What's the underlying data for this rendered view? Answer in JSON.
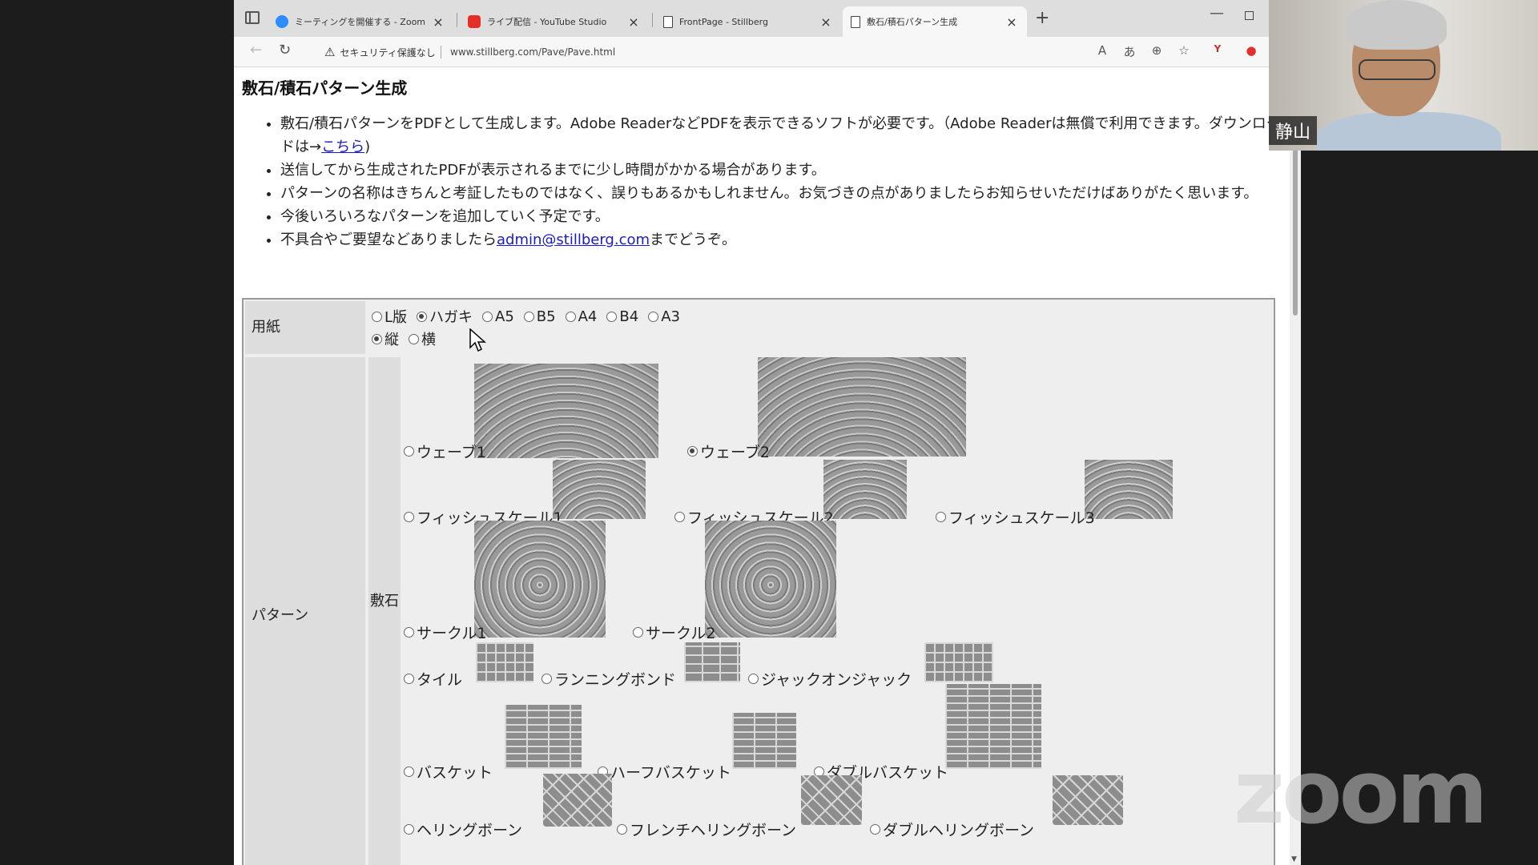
{
  "browser": {
    "tabs": [
      {
        "label": "ミーティングを開催する - Zoom",
        "favicon": "zoom-icon"
      },
      {
        "label": "ライブ配信 - YouTube Studio",
        "favicon": "youtube-icon"
      },
      {
        "label": "FrontPage - Stillberg",
        "favicon": "document-icon"
      },
      {
        "label": "敷石/積石パターン生成",
        "favicon": "document-icon",
        "active": true
      }
    ],
    "security_label": "セキュリティ保護なし",
    "url": "www.stillberg.com/Pave/Pave.html"
  },
  "page": {
    "title": "敷石/積石パターン生成",
    "bullets": {
      "b1_text": "敷石/積石パターンをPDFとして生成します。Adobe ReaderなどPDFを表示できるソフトが必要です。（Adobe Readerは無償で利用できます。ダウンロードは→",
      "b1_link": "こちら",
      "b1_end": ")",
      "b2": "送信してから生成されたPDFが表示されるまでに少し時間がかかる場合があります。",
      "b3": "パターンの名称はきちんと考証したものではなく、誤りもあるかもしれません。お気づきの点がありましたらお知らせいただけばありがたく思います。",
      "b4": "今後いろいろなパターンを追加していく予定です。",
      "b5_text": "不具合やご要望などありましたら",
      "b5_link": "admin@stillberg.com",
      "b5_end": "までどうぞ。"
    },
    "form": {
      "paper_label": "用紙",
      "paper_sizes": [
        "L版",
        "ハガキ",
        "A5",
        "B5",
        "A4",
        "B4",
        "A3"
      ],
      "paper_selected": "ハガキ",
      "orientations": [
        "縦",
        "横"
      ],
      "orientation_selected": "縦",
      "pattern_label": "パターン",
      "pave_label": "敷石",
      "patterns": {
        "wave1": "ウェーブ1",
        "wave2": "ウェーブ2",
        "fish1": "フィッシュスケール1",
        "fish2": "フィッシュスケール2",
        "fish3": "フィッシュスケール3",
        "circle1": "サークル1",
        "circle2": "サークル2",
        "tile": "タイル",
        "running": "ランニングボンド",
        "jack": "ジャックオンジャック",
        "basket": "バスケット",
        "half_basket": "ハーフバスケット",
        "double_basket": "ダブルバスケット",
        "herring": "ヘリングボーン",
        "french_herring": "フレンチヘリングボーン",
        "double_herring": "ダブルヘリングボーン"
      },
      "pattern_selected": "ウェーブ2"
    }
  },
  "zoom": {
    "participant_name": "静山",
    "watermark": "zoom"
  }
}
